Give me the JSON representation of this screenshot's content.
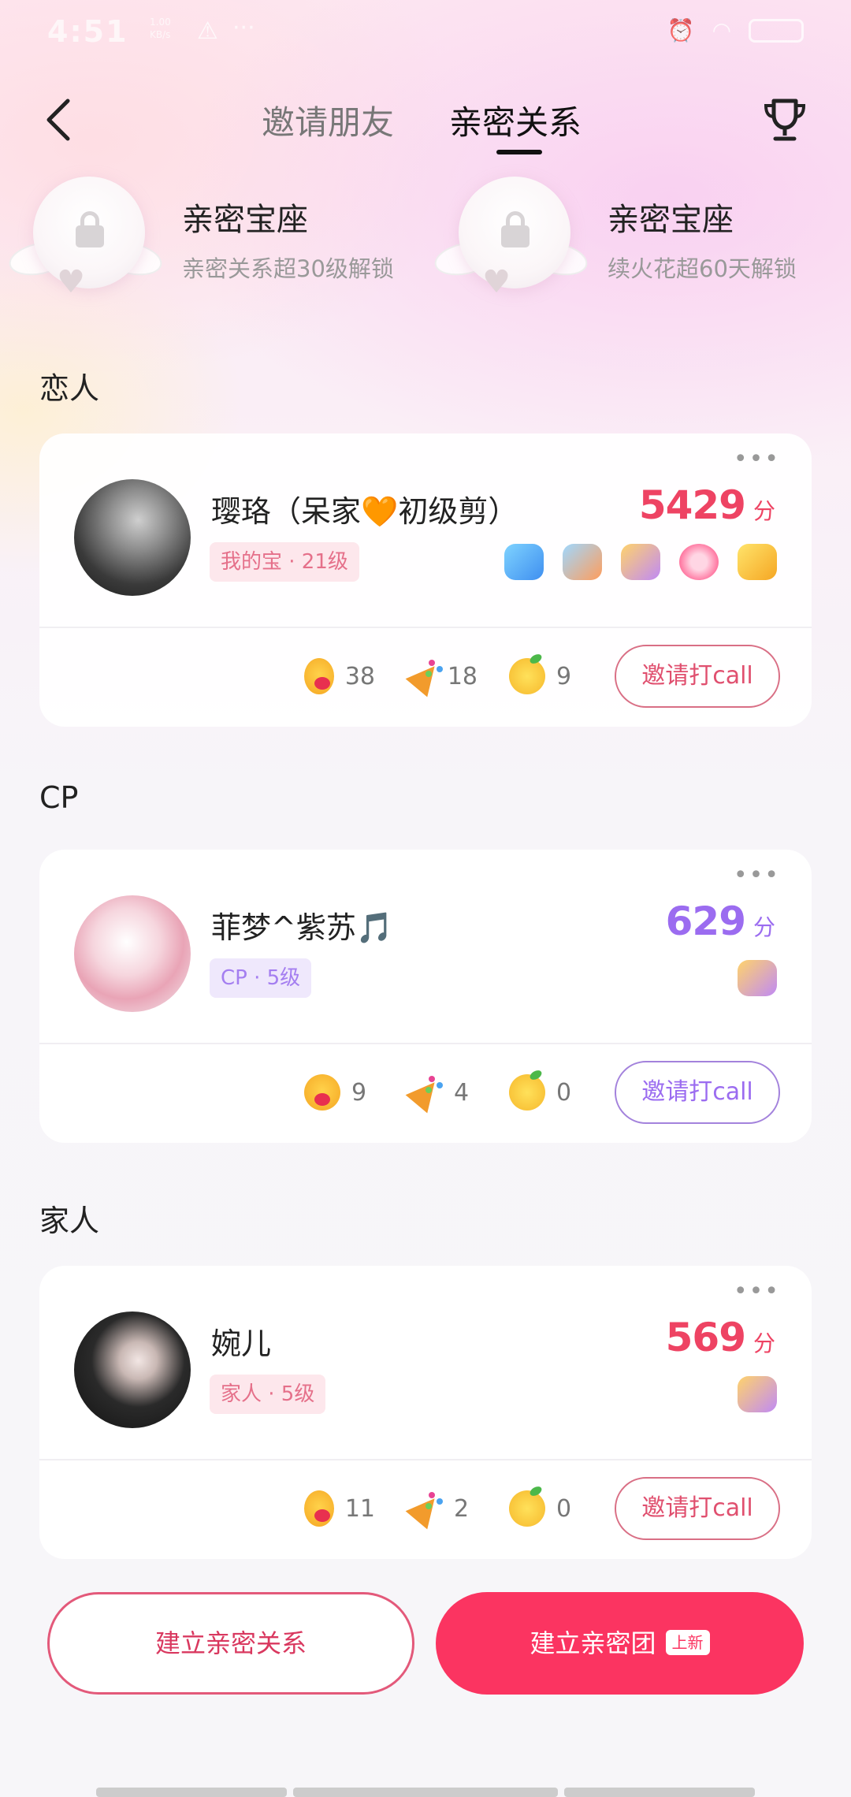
{
  "status_bar": {
    "time": "4:51",
    "net_speed": "1.00 KB/s",
    "icons": [
      "warning-icon",
      "more-dots-icon",
      "alarm-icon",
      "wifi-icon",
      "battery-icon"
    ]
  },
  "header": {
    "tabs": [
      {
        "label": "邀请朋友",
        "active": false
      },
      {
        "label": "亲密关系",
        "active": true
      }
    ],
    "icons": [
      "back-icon",
      "trophy-icon"
    ]
  },
  "seats": [
    {
      "title": "亲密宝座",
      "desc": "亲密关系超30级解锁",
      "icon": "lock-icon"
    },
    {
      "title": "亲密宝座",
      "desc": "续火花超60天解锁",
      "icon": "lock-icon"
    }
  ],
  "sections": [
    {
      "title": "恋人",
      "card": {
        "name": "璎珞（呆家🧡初级剪）",
        "tag": "我的宝 · 21级",
        "score": "5429",
        "score_unit": "分",
        "badges": [
          "megaphone-badge",
          "thumb-badge",
          "gift-badge",
          "ring-badge",
          "crown-badge"
        ],
        "stats": [
          {
            "icon": "blush-face-icon",
            "value": "38"
          },
          {
            "icon": "party-popper-icon",
            "value": "18"
          },
          {
            "icon": "lemon-face-icon",
            "value": "9"
          }
        ],
        "call_label": "邀请打call"
      }
    },
    {
      "title": "CP",
      "card": {
        "name": "菲梦^紫苏🎵",
        "tag": "CP · 5级",
        "score": "629",
        "score_unit": "分",
        "badges": [
          "gift-badge"
        ],
        "stats": [
          {
            "icon": "blush-face-icon",
            "value": "9"
          },
          {
            "icon": "party-popper-icon",
            "value": "4"
          },
          {
            "icon": "lemon-face-icon",
            "value": "0"
          }
        ],
        "call_label": "邀请打call"
      }
    },
    {
      "title": "家人",
      "card": {
        "name": "婉儿",
        "tag": "家人 · 5级",
        "score": "569",
        "score_unit": "分",
        "badges": [
          "gift-badge"
        ],
        "stats": [
          {
            "icon": "blush-face-icon",
            "value": "11"
          },
          {
            "icon": "party-popper-icon",
            "value": "2"
          },
          {
            "icon": "lemon-face-icon",
            "value": "0"
          }
        ],
        "call_label": "邀请打call"
      }
    }
  ],
  "bottom": {
    "build_relation": "建立亲密关系",
    "build_group": "建立亲密团",
    "new_tag": "上新"
  },
  "colors": {
    "accent_red": "#fb3461",
    "score_red": "#ee4363",
    "cp_purple": "#9b6cf0"
  }
}
